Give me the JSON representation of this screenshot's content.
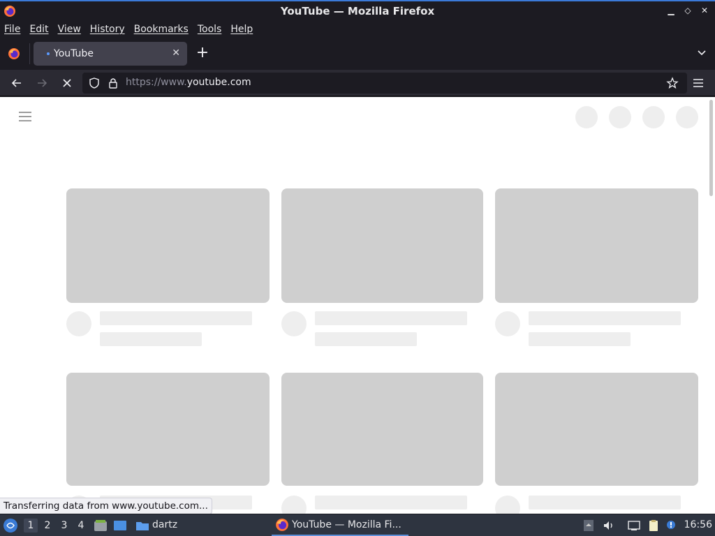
{
  "window": {
    "title": "YouTube — Mozilla Firefox",
    "controls": [
      "▁",
      "◇",
      "✕"
    ]
  },
  "menu": {
    "file": "File",
    "edit": "Edit",
    "view": "View",
    "history": "History",
    "bookmarks": "Bookmarks",
    "tools": "Tools",
    "help": "Help"
  },
  "tabs": {
    "active_title": "YouTube",
    "close": "✕",
    "new_tab": "+"
  },
  "nav": {
    "url_prefix": "https://www.",
    "url_domain": "youtube.com"
  },
  "status": {
    "text": "Transferring data from www.youtube.com..."
  },
  "taskbar": {
    "workspaces": [
      "1",
      "2",
      "3",
      "4"
    ],
    "folder_label": "dartz",
    "task_title": "YouTube — Mozilla Fi...",
    "clock": "16:56"
  },
  "colors": {
    "accent": "#3b7ad9",
    "skeleton_thumb": "#cfcfcf",
    "skeleton_line": "#eeeeee"
  }
}
